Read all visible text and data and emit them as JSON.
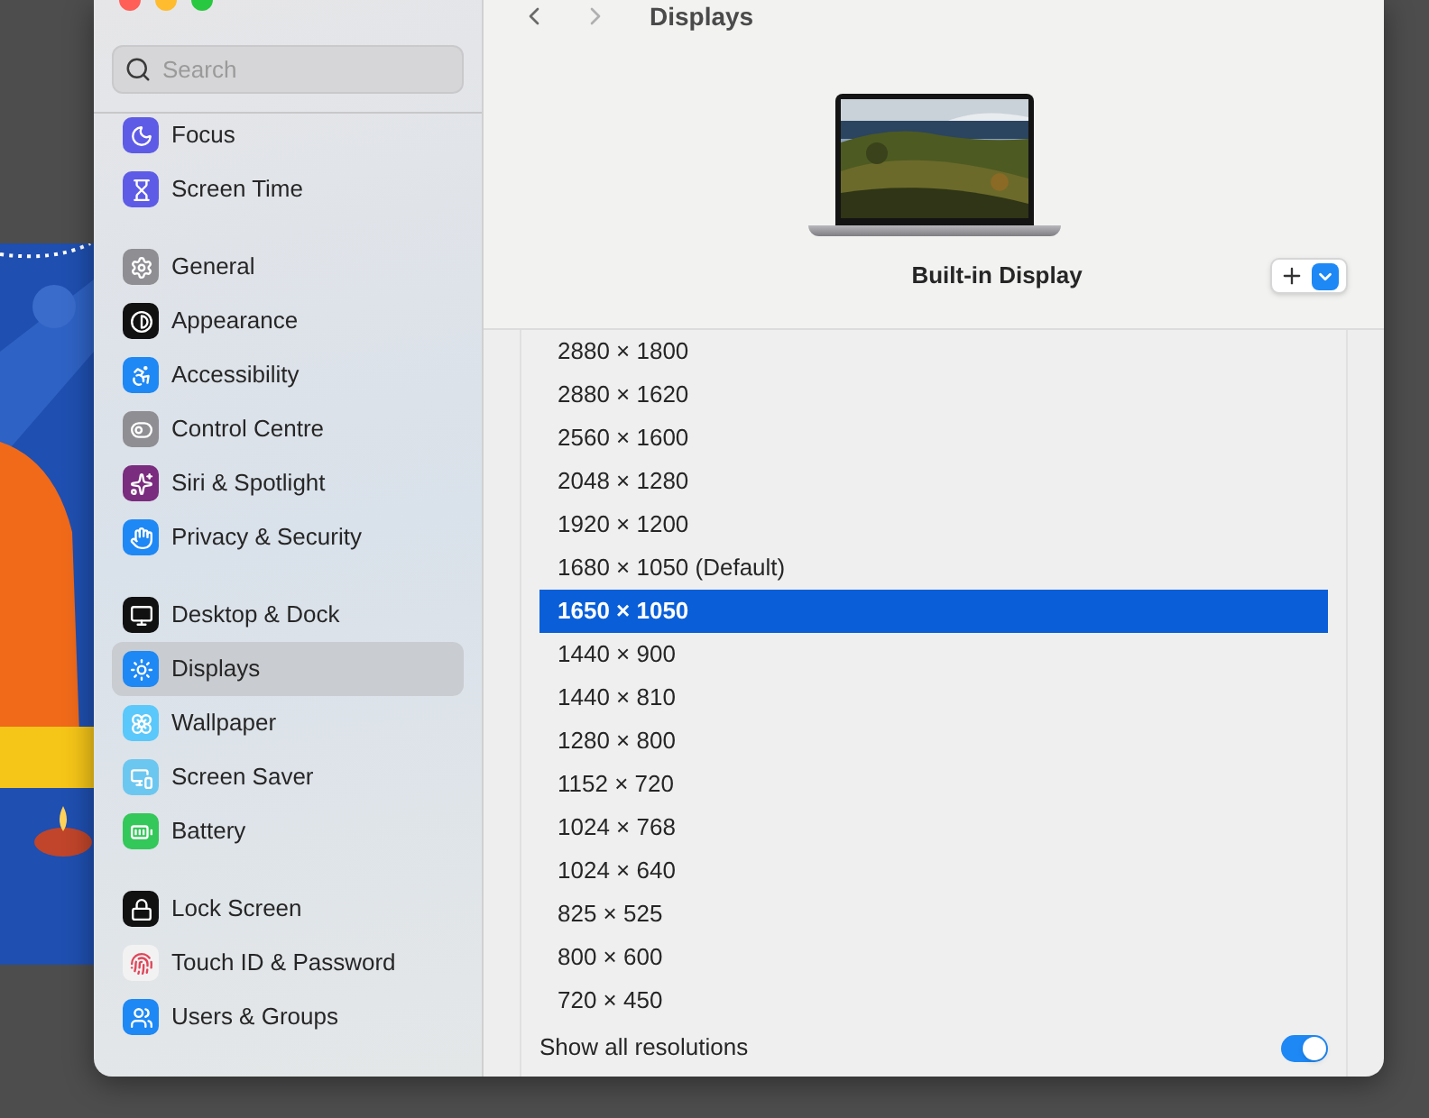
{
  "window": {
    "title": "Displays"
  },
  "sidebar": {
    "search": {
      "placeholder": "Search"
    },
    "groups": [
      {
        "items": [
          {
            "label": "Focus",
            "selected": false,
            "color": "#5e5ce6"
          },
          {
            "label": "Screen Time",
            "selected": false,
            "color": "#5e5ce6"
          }
        ]
      },
      {
        "items": [
          {
            "label": "General",
            "selected": false,
            "color": "#8e8e93"
          },
          {
            "label": "Appearance",
            "selected": false,
            "color": "#111111"
          },
          {
            "label": "Accessibility",
            "selected": false,
            "color": "#1e88f5"
          },
          {
            "label": "Control Centre",
            "selected": false,
            "color": "#8e8e93"
          },
          {
            "label": "Siri & Spotlight",
            "selected": false,
            "color": "#7a2c7e"
          },
          {
            "label": "Privacy & Security",
            "selected": false,
            "color": "#1e88f5"
          }
        ]
      },
      {
        "items": [
          {
            "label": "Desktop & Dock",
            "selected": false,
            "color": "#111111"
          },
          {
            "label": "Displays",
            "selected": true,
            "color": "#1e88f5"
          },
          {
            "label": "Wallpaper",
            "selected": false,
            "color": "#5ac8fa"
          },
          {
            "label": "Screen Saver",
            "selected": false,
            "color": "#6cc7f0"
          },
          {
            "label": "Battery",
            "selected": false,
            "color": "#34c759"
          }
        ]
      },
      {
        "items": [
          {
            "label": "Lock Screen",
            "selected": false,
            "color": "#111111"
          },
          {
            "label": "Touch ID & Password",
            "selected": false,
            "color": "#f2f2f2"
          },
          {
            "label": "Users & Groups",
            "selected": false,
            "color": "#1e88f5"
          }
        ]
      }
    ]
  },
  "display": {
    "name": "Built-in Display"
  },
  "resolutions": [
    {
      "label": "2880 × 1800",
      "selected": false
    },
    {
      "label": "2880 × 1620",
      "selected": false
    },
    {
      "label": "2560 × 1600",
      "selected": false
    },
    {
      "label": "2048 × 1280",
      "selected": false
    },
    {
      "label": "1920 × 1200",
      "selected": false
    },
    {
      "label": "1680 × 1050 (Default)",
      "selected": false
    },
    {
      "label": "1650 × 1050",
      "selected": true
    },
    {
      "label": "1440 × 900",
      "selected": false
    },
    {
      "label": "1440 × 810",
      "selected": false
    },
    {
      "label": "1280 × 800",
      "selected": false
    },
    {
      "label": "1152 × 720",
      "selected": false
    },
    {
      "label": "1024 × 768",
      "selected": false
    },
    {
      "label": "1024 × 640",
      "selected": false
    },
    {
      "label": "825 × 525",
      "selected": false
    },
    {
      "label": "800 × 600",
      "selected": false
    },
    {
      "label": "720 × 450",
      "selected": false
    }
  ],
  "show_all": {
    "label": "Show all resolutions",
    "on": true
  }
}
